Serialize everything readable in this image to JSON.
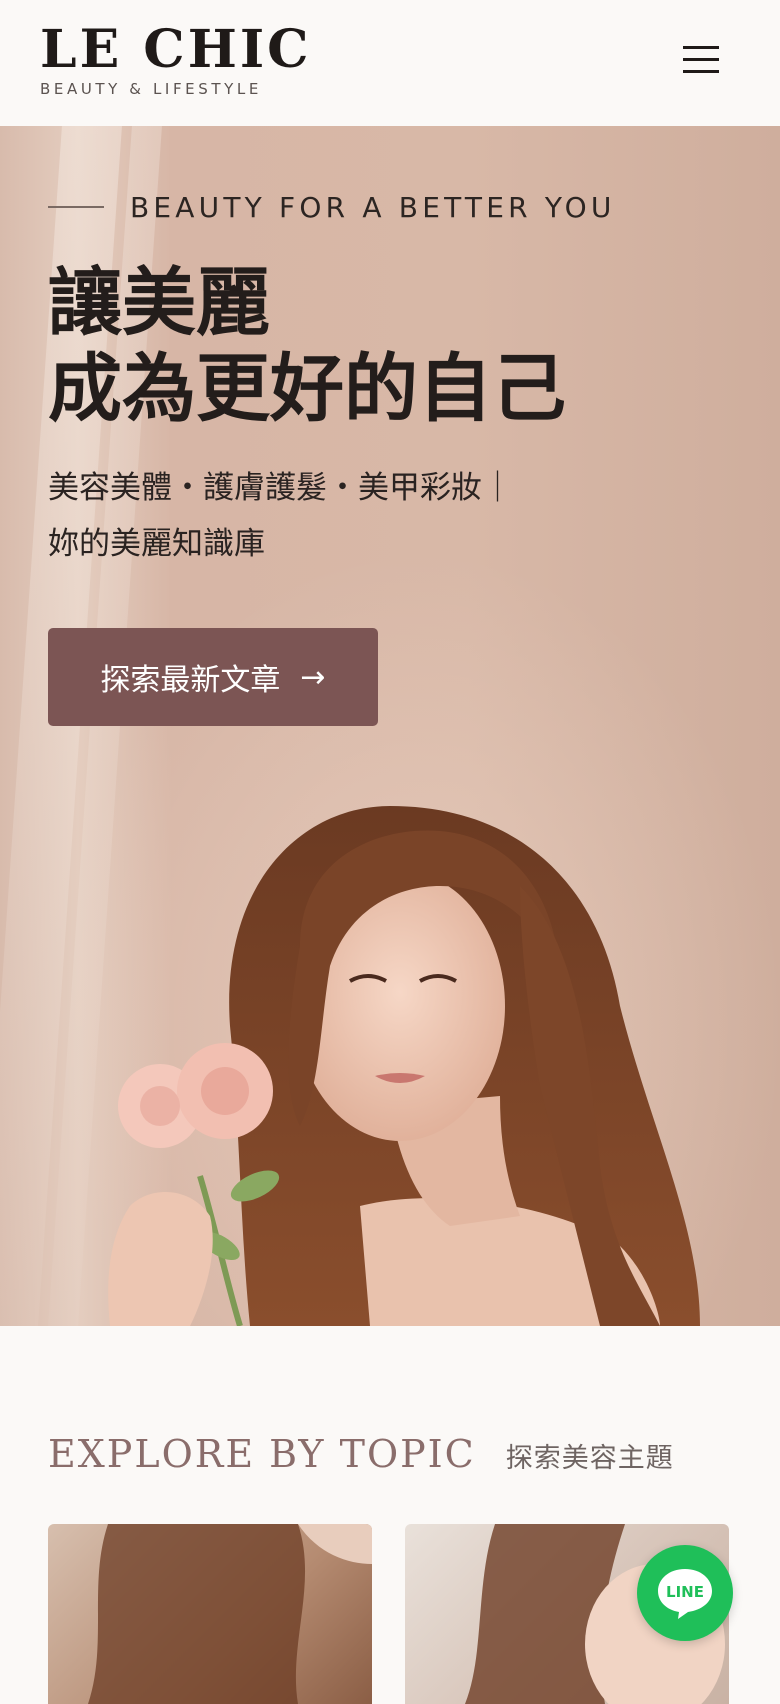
{
  "header": {
    "brand_name": "LE CHIC",
    "brand_tagline": "BEAUTY & LIFESTYLE",
    "menu_icon": "hamburger-menu-icon"
  },
  "hero": {
    "eyebrow": "BEAUTY FOR A BETTER YOU",
    "title_line1": "讓美麗",
    "title_line2": "成為更好的自己",
    "subtitle_line1": "美容美體・護膚護髮・美甲彩妝｜",
    "subtitle_line2": "妳的美麗知識庫",
    "cta_label": "探索最新文章",
    "cta_icon": "arrow-right-icon"
  },
  "topics": {
    "title": "EXPLORE BY TOPIC",
    "subtitle": "探索美容主題"
  },
  "floating": {
    "line_label": "LINE"
  },
  "colors": {
    "accent": "#7c5554",
    "background": "#fbf9f7",
    "line_green": "#1fbf59"
  }
}
